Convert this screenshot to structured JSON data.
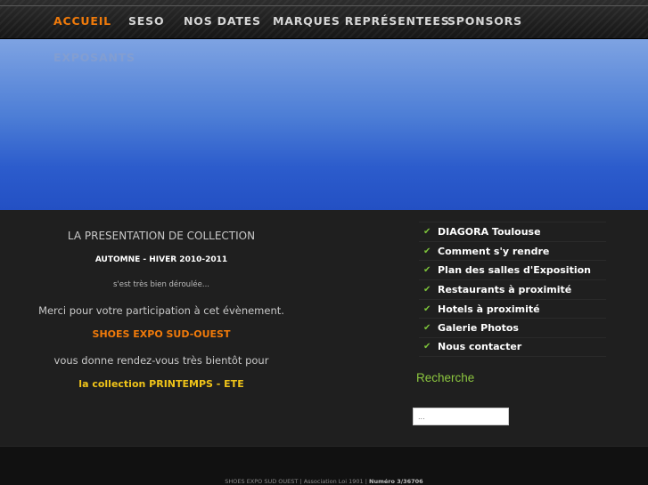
{
  "nav": {
    "items": [
      {
        "label": "ACCUEIL",
        "active": true
      },
      {
        "label": "SESO"
      },
      {
        "label": "NOS DATES"
      },
      {
        "label": "MARQUES REPRÉSENTEES"
      },
      {
        "label": "SPONSORS"
      },
      {
        "label": "EXPOSANTS"
      }
    ]
  },
  "main": {
    "line1": "LA PRESENTATION DE COLLECTION",
    "line2": "AUTOMNE - HIVER 2010-2011",
    "line3": "s'est très bien déroulée...",
    "line4": "Merci pour votre participation à cet évènement.",
    "line5": "SHOES EXPO SUD-OUEST",
    "line6": "vous donne rendez-vous très bientôt pour",
    "line7": "la collection PRINTEMPS - ETE"
  },
  "sidebar": {
    "items": [
      {
        "label": "DIAGORA Toulouse"
      },
      {
        "label": "Comment s'y rendre"
      },
      {
        "label": "Plan des salles d'Exposition"
      },
      {
        "label": "Restaurants à proximité"
      },
      {
        "label": "Hotels à proximité"
      },
      {
        "label": "Galerie Photos"
      },
      {
        "label": "Nous contacter"
      }
    ],
    "check_icon": "check-icon"
  },
  "search": {
    "title": "Recherche",
    "placeholder": "..."
  },
  "footer": {
    "text": "SHOES EXPO SUD OUEST | Association Loi 1901 | ",
    "number": "Numéro 3/36706"
  },
  "colors": {
    "accent": "#f07a0a",
    "yellow": "#f0c419",
    "green": "#8cc63f",
    "banner_top": "#7ea3e2",
    "banner_bottom": "#2350c4"
  }
}
